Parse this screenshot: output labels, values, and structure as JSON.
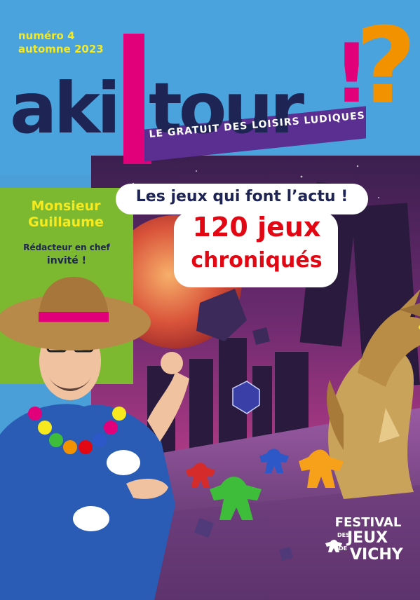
{
  "issue": {
    "number": "numéro 4",
    "season": "automne 2023"
  },
  "logo": {
    "word_left": "aki",
    "word_right": "tour",
    "tagline": "LE GRATUIT DES LOISIRS LUDIQUES"
  },
  "guest": {
    "name_line1": "Monsieur",
    "name_line2": "Guillaume",
    "role": "Rédacteur en chef",
    "invite": "invité !"
  },
  "headline": {
    "line1": "Les jeux qui font l’actu !",
    "line2": "120 jeux",
    "line3": "chroniqués"
  },
  "festival": {
    "word1": "FESTIVAL",
    "word2": "DES",
    "word3": "JEUX",
    "word4": "DE",
    "word5": "VICHY"
  },
  "colors": {
    "sky": "#4aa3dc",
    "navy": "#1e2453",
    "magenta": "#e2007a",
    "orange": "#f39200",
    "purple": "#5b2e91",
    "green": "#7cb930",
    "yellow": "#f6e91d",
    "red": "#e30613"
  }
}
